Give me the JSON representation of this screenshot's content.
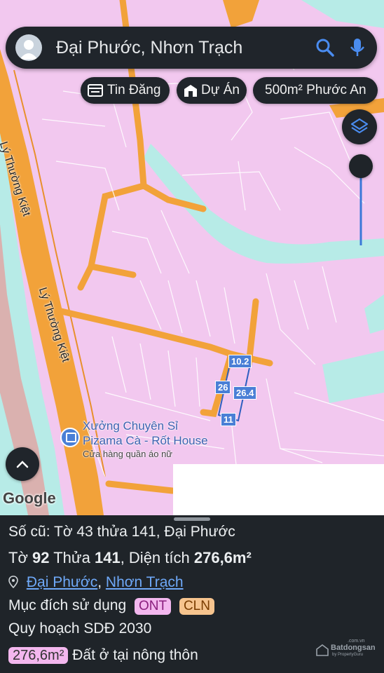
{
  "search": {
    "query": "Đại Phước, Nhơn Trạch"
  },
  "chips": [
    {
      "label": "Tin Đăng",
      "icon": "news-icon"
    },
    {
      "label": "Dự Án",
      "icon": "building-icon"
    },
    {
      "label": "500m² Phước An",
      "icon": ""
    }
  ],
  "map": {
    "road_label_1": "Lý Thường Kiệt",
    "road_label_2": "Lý Thường Kiệt",
    "poi_name_line1": "Xưởng Chuyên Sỉ",
    "poi_name_line2": "Pizama Cà - Rốt House",
    "poi_category": "Cửa hàng quần áo nữ",
    "dimensions": [
      "10.2",
      "26",
      "26.4",
      "11"
    ],
    "google_logo": "Google",
    "colors": {
      "residential": "#f2c8ef",
      "road": "#f2a23a",
      "water": "#b7ebe7",
      "dimension": "#4a7fd6"
    }
  },
  "panel": {
    "old_record": "Số cũ: Tờ 43 thửa 141, Đại Phước",
    "sheet_label": "Tờ",
    "sheet_no": "92",
    "parcel_label": "Thửa",
    "parcel_no": "141",
    "area_label": ", Diện tích",
    "area_value": "276,6m²",
    "location_ward": "Đại Phước",
    "location_sep": ",",
    "location_district": "Nhơn Trạch",
    "purpose_label": "Mục đích sử dụng",
    "purpose_tags": [
      {
        "code": "ONT",
        "color": "#f3b7ee"
      },
      {
        "code": "CLN",
        "color": "#f6c48e"
      }
    ],
    "plan_label": "Quy hoạch SDĐ 2030",
    "plan_area": "276,6m²",
    "plan_desc": "Đất ở tại nông thôn",
    "brand_name": "Batdongsan",
    "brand_sub": "by PropertyGuru",
    "brand_domain": ".com.vn"
  }
}
